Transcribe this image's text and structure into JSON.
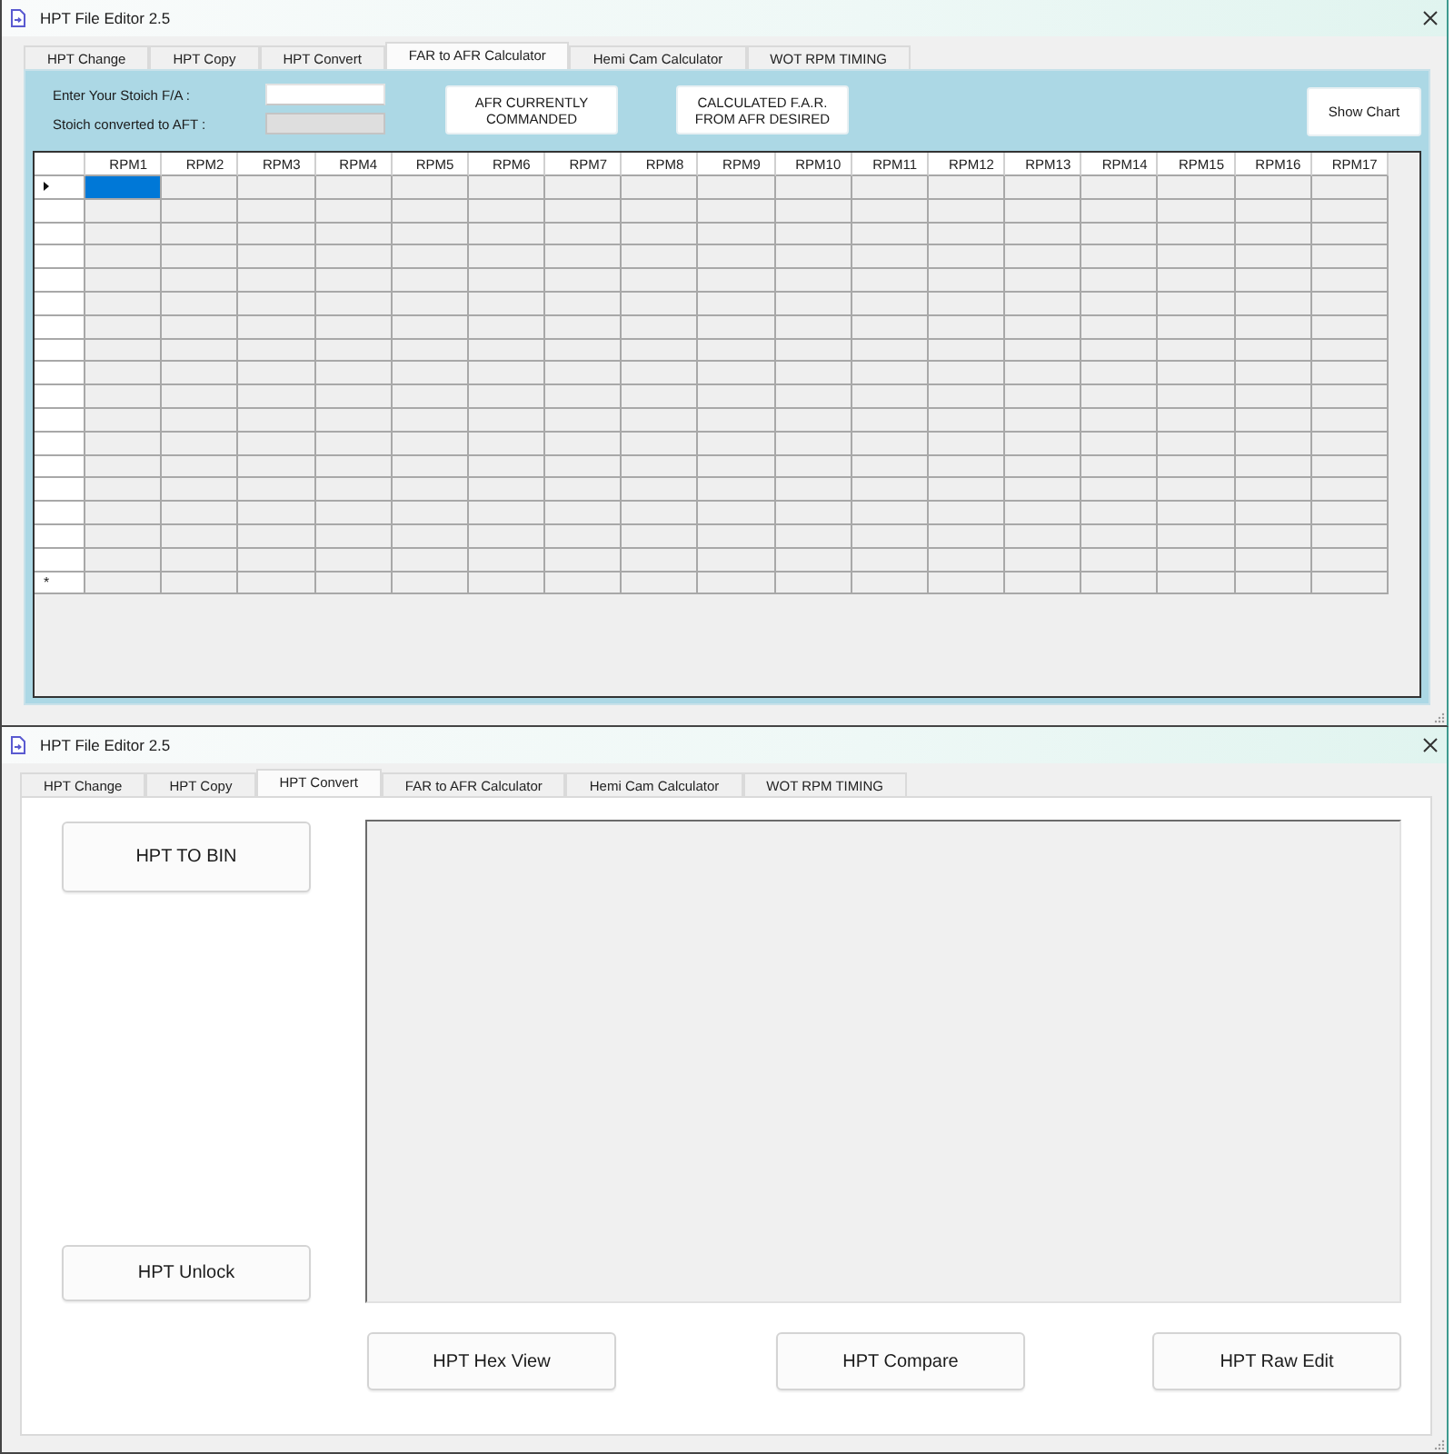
{
  "windows": [
    {
      "kind": "far_calculator",
      "title": "HPT File Editor 2.5",
      "tabs": [
        {
          "label": "HPT Change",
          "selected": false
        },
        {
          "label": "HPT Copy",
          "selected": false
        },
        {
          "label": "HPT Convert",
          "selected": false
        },
        {
          "label": "FAR to AFR Calculator",
          "selected": true
        },
        {
          "label": "Hemi Cam Calculator",
          "selected": false
        },
        {
          "label": "WOT RPM TIMING",
          "selected": false
        }
      ],
      "fields": [
        {
          "label": "Enter Your Stoich F/A :",
          "disabled": false
        },
        {
          "label": "Stoich converted to AFT :",
          "disabled": true
        }
      ],
      "buttons": [
        "AFR CURRENTLY COMMANDED",
        "CALCULATED F.A.R. FROM AFR DESIRED"
      ],
      "chart_button": "Show Chart",
      "grid": {
        "columns": [
          {
            "label": "RPM1",
            "selected": true
          },
          {
            "label": "RPM2",
            "selected": false
          },
          {
            "label": "RPM3",
            "selected": false
          },
          {
            "label": "RPM4",
            "selected": false
          },
          {
            "label": "RPM5",
            "selected": false
          },
          {
            "label": "RPM6",
            "selected": false
          },
          {
            "label": "RPM7",
            "selected": false
          },
          {
            "label": "RPM8",
            "selected": false
          },
          {
            "label": "RPM9",
            "selected": false
          },
          {
            "label": "RPM10",
            "selected": false
          },
          {
            "label": "RPM11",
            "selected": false
          },
          {
            "label": "RPM12",
            "selected": false
          },
          {
            "label": "RPM13",
            "selected": false
          },
          {
            "label": "RPM14",
            "selected": false
          },
          {
            "label": "RPM15",
            "selected": false
          },
          {
            "label": "RPM16",
            "selected": false
          },
          {
            "label": "RPM17",
            "selected": false
          }
        ],
        "rows": [
          {
            "kind": "data",
            "selected": true
          },
          {
            "kind": "data",
            "selected": false
          },
          {
            "kind": "data",
            "selected": false
          },
          {
            "kind": "data",
            "selected": false
          },
          {
            "kind": "data",
            "selected": false
          },
          {
            "kind": "data",
            "selected": false
          },
          {
            "kind": "data",
            "selected": false
          },
          {
            "kind": "data",
            "selected": false
          },
          {
            "kind": "data",
            "selected": false
          },
          {
            "kind": "data",
            "selected": false
          },
          {
            "kind": "data",
            "selected": false
          },
          {
            "kind": "data",
            "selected": false
          },
          {
            "kind": "data",
            "selected": false
          },
          {
            "kind": "data",
            "selected": false
          },
          {
            "kind": "data",
            "selected": false
          },
          {
            "kind": "data",
            "selected": false
          },
          {
            "kind": "data",
            "selected": false
          },
          {
            "kind": "new",
            "selected": false,
            "marker": "*"
          }
        ]
      }
    },
    {
      "kind": "hpt_convert",
      "title": "HPT File Editor 2.5",
      "tabs": [
        {
          "label": "HPT Change",
          "selected": false
        },
        {
          "label": "HPT Copy",
          "selected": false
        },
        {
          "label": "HPT Convert",
          "selected": true
        },
        {
          "label": "FAR to AFR Calculator",
          "selected": false
        },
        {
          "label": "Hemi Cam Calculator",
          "selected": false
        },
        {
          "label": "WOT RPM TIMING",
          "selected": false
        }
      ],
      "side_buttons": [
        "HPT TO BIN",
        "HPT Unlock"
      ],
      "bottom_buttons": [
        "HPT Hex View",
        "HPT Compare",
        "HPT Raw Edit"
      ]
    }
  ]
}
